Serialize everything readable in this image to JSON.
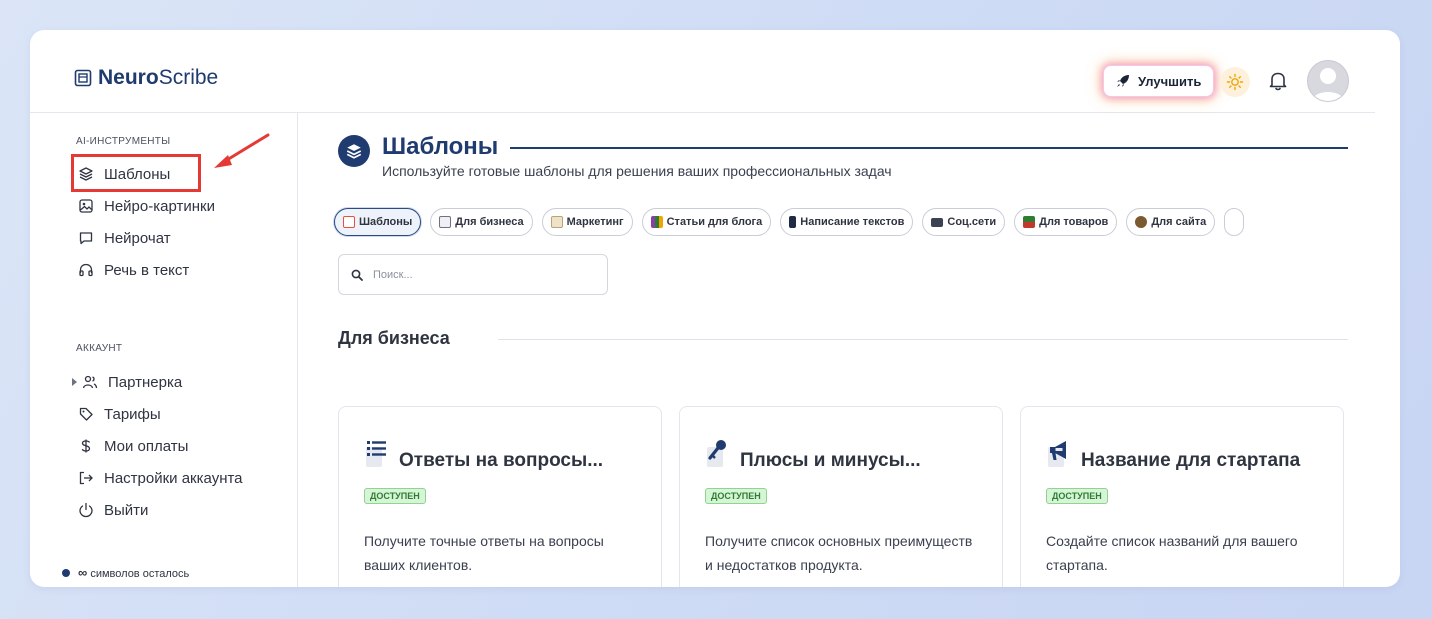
{
  "app": {
    "logo_bold": "Neuro",
    "logo_rest": "Scribe"
  },
  "header": {
    "upgrade_label": "Улучшить"
  },
  "sidebar": {
    "section_tools": "AI-ИНСТРУМЕНТЫ",
    "tools": [
      {
        "label": "Шаблоны",
        "icon": "layers-icon"
      },
      {
        "label": "Нейро-картинки",
        "icon": "image-icon"
      },
      {
        "label": "Нейрочат",
        "icon": "chat-icon"
      },
      {
        "label": "Речь в текст",
        "icon": "headphones-icon"
      }
    ],
    "section_account": "АККАУНТ",
    "account": [
      {
        "label": "Партнерка",
        "icon": "users-icon"
      },
      {
        "label": "Тарифы",
        "icon": "tag-icon"
      },
      {
        "label": "Мои оплаты",
        "icon": "dollar-icon"
      },
      {
        "label": "Настройки аккаунта",
        "icon": "logout-arrow-icon"
      },
      {
        "label": "Выйти",
        "icon": "power-icon"
      }
    ],
    "credits_value": "∞",
    "credits_label": "символов осталось"
  },
  "main": {
    "title": "Шаблоны",
    "subtitle": "Используйте готовые шаблоны для решения ваших профессиональных задач",
    "chips": [
      {
        "label": "Шаблоны",
        "active": true,
        "color": "#e8503a"
      },
      {
        "label": "Для бизнеса",
        "color": "#6b7280"
      },
      {
        "label": "Маркетинг",
        "color": "#b9a37a"
      },
      {
        "label": "Статьи для блога",
        "color": "#8b3fa8"
      },
      {
        "label": "Написание текстов",
        "color": "#1f2a44"
      },
      {
        "label": "Соц.сети",
        "color": "#3b4252"
      },
      {
        "label": "Для товаров",
        "color": "#2e7d32"
      },
      {
        "label": "Для сайта",
        "color": "#7a5a2e"
      }
    ],
    "search_placeholder": "Поиск...",
    "section_title": "Для бизнеса",
    "cards": [
      {
        "title": "Ответы на вопросы...",
        "badge": "ДОСТУПЕН",
        "desc": "Получите точные ответы на вопросы ваших клиентов.",
        "icon": "list-icon"
      },
      {
        "title": "Плюсы и минусы...",
        "badge": "ДОСТУПЕН",
        "desc": "Получите список основных преимуществ и недостатков продукта.",
        "icon": "key-icon"
      },
      {
        "title": "Название для стартапа",
        "badge": "ДОСТУПЕН",
        "desc": "Создайте список названий для вашего стартапа.",
        "icon": "megaphone-icon"
      }
    ]
  },
  "colors": {
    "brand": "#1f3b6f",
    "highlight": "#e53935",
    "badge_bg": "#d6f5d6"
  }
}
